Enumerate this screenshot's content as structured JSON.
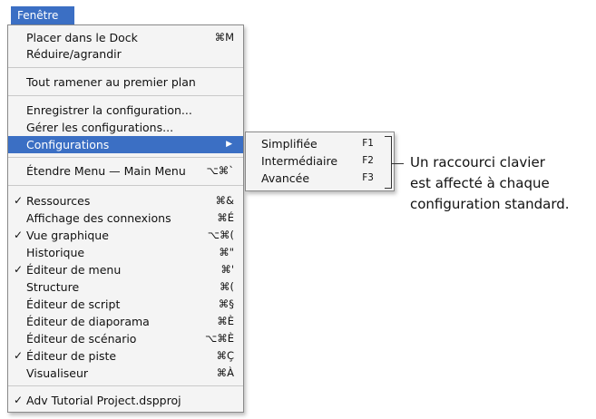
{
  "menu_title": "Fenêtre",
  "items": [
    {
      "label": "Placer dans le Dock",
      "shortcut": "⌘M",
      "check": ""
    },
    {
      "label": "Réduire/agrandir",
      "shortcut": "",
      "check": ""
    },
    {
      "label": "Tout ramener au premier plan",
      "shortcut": "",
      "check": ""
    },
    {
      "label": "Enregistrer la configuration...",
      "shortcut": "",
      "check": ""
    },
    {
      "label": "Gérer les configurations...",
      "shortcut": "",
      "check": ""
    },
    {
      "label": "Configurations",
      "shortcut": "",
      "check": "",
      "arrow": "▶"
    },
    {
      "label": "Étendre Menu — Main Menu",
      "shortcut": "⌥⌘`",
      "check": ""
    },
    {
      "label": "Ressources",
      "shortcut": "⌘&",
      "check": "✓"
    },
    {
      "label": "Affichage des connexions",
      "shortcut": "⌘É",
      "check": ""
    },
    {
      "label": "Vue graphique",
      "shortcut": "⌥⌘(",
      "check": "✓"
    },
    {
      "label": "Historique",
      "shortcut": "⌘\"",
      "check": ""
    },
    {
      "label": "Éditeur de menu",
      "shortcut": "⌘'",
      "check": "✓"
    },
    {
      "label": "Structure",
      "shortcut": "⌘(",
      "check": ""
    },
    {
      "label": "Éditeur de script",
      "shortcut": "⌘§",
      "check": ""
    },
    {
      "label": "Éditeur de diaporama",
      "shortcut": "⌘È",
      "check": ""
    },
    {
      "label": "Éditeur de scénario",
      "shortcut": "⌥⌘È",
      "check": ""
    },
    {
      "label": "Éditeur de piste",
      "shortcut": "⌘Ç",
      "check": "✓"
    },
    {
      "label": "Visualiseur",
      "shortcut": "⌘À",
      "check": ""
    },
    {
      "label": "Adv Tutorial Project.dspproj",
      "shortcut": "",
      "check": "✓"
    }
  ],
  "submenu": [
    {
      "label": "Simplifiée",
      "shortcut": "F1"
    },
    {
      "label": "Intermédiaire",
      "shortcut": "F2"
    },
    {
      "label": "Avancée",
      "shortcut": "F3"
    }
  ],
  "callout": {
    "line1": "Un raccourci clavier",
    "line2": "est affecté à chaque",
    "line3": "configuration standard."
  },
  "colors": {
    "selection": "#3b6fc4",
    "menu_bg": "#f4f4f4"
  }
}
